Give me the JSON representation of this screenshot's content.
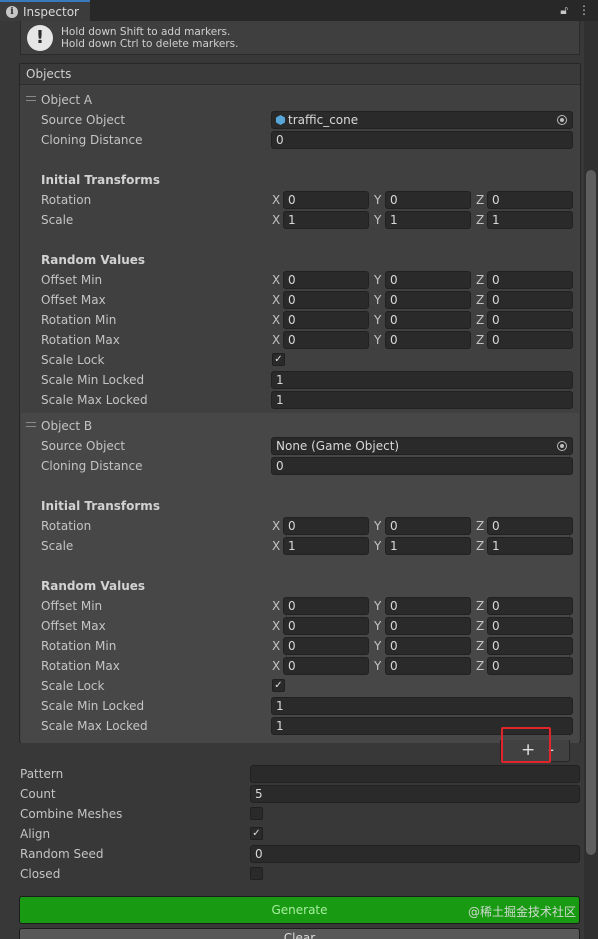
{
  "tab": {
    "title": "Inspector",
    "lock_icon": "lock-icon",
    "menu_icon": "kebab-menu-icon"
  },
  "help": {
    "line1": "Hold down Shift to add markers.",
    "line2": "Hold down Ctrl to delete markers.",
    "icon": "exclamation-icon"
  },
  "objects": {
    "header": "Objects",
    "a": {
      "title": "Object A",
      "source_label": "Source Object",
      "source_value": "traffic_cone",
      "cloning_label": "Cloning Distance",
      "cloning_value": "0",
      "initial_header": "Initial Transforms",
      "rotation_label": "Rotation",
      "rotation": {
        "x": "0",
        "y": "0",
        "z": "0"
      },
      "scale_label": "Scale",
      "scale": {
        "x": "1",
        "y": "1",
        "z": "1"
      },
      "random_header": "Random Values",
      "offset_min_label": "Offset Min",
      "offset_min": {
        "x": "0",
        "y": "0",
        "z": "0"
      },
      "offset_max_label": "Offset Max",
      "offset_max": {
        "x": "0",
        "y": "0",
        "z": "0"
      },
      "rot_min_label": "Rotation Min",
      "rot_min": {
        "x": "0",
        "y": "0",
        "z": "0"
      },
      "rot_max_label": "Rotation Max",
      "rot_max": {
        "x": "0",
        "y": "0",
        "z": "0"
      },
      "scale_lock_label": "Scale Lock",
      "scale_lock": true,
      "scale_min_locked_label": "Scale Min Locked",
      "scale_min_locked": "1",
      "scale_max_locked_label": "Scale Max Locked",
      "scale_max_locked": "1"
    },
    "b": {
      "title": "Object B",
      "source_label": "Source Object",
      "source_value": "None (Game Object)",
      "cloning_label": "Cloning Distance",
      "cloning_value": "0",
      "initial_header": "Initial Transforms",
      "rotation_label": "Rotation",
      "rotation": {
        "x": "0",
        "y": "0",
        "z": "0"
      },
      "scale_label": "Scale",
      "scale": {
        "x": "1",
        "y": "1",
        "z": "1"
      },
      "random_header": "Random Values",
      "offset_min_label": "Offset Min",
      "offset_min": {
        "x": "0",
        "y": "0",
        "z": "0"
      },
      "offset_max_label": "Offset Max",
      "offset_max": {
        "x": "0",
        "y": "0",
        "z": "0"
      },
      "rot_min_label": "Rotation Min",
      "rot_min": {
        "x": "0",
        "y": "0",
        "z": "0"
      },
      "rot_max_label": "Rotation Max",
      "rot_max": {
        "x": "0",
        "y": "0",
        "z": "0"
      },
      "scale_lock_label": "Scale Lock",
      "scale_lock": true,
      "scale_min_locked_label": "Scale Min Locked",
      "scale_min_locked": "1",
      "scale_max_locked_label": "Scale Max Locked",
      "scale_max_locked": "1"
    },
    "add_label": "+",
    "remove_label": "-"
  },
  "axes": {
    "x": "X",
    "y": "Y",
    "z": "Z"
  },
  "props": {
    "pattern_label": "Pattern",
    "pattern_value": "",
    "count_label": "Count",
    "count_value": "5",
    "combine_label": "Combine Meshes",
    "combine_checked": false,
    "align_label": "Align",
    "align_checked": true,
    "seed_label": "Random Seed",
    "seed_value": "0",
    "closed_label": "Closed",
    "closed_checked": false
  },
  "buttons": {
    "generate": "Generate",
    "clear": "Clear"
  },
  "watermark": "@稀土掘金技术社区",
  "colors": {
    "accent": "#3a79bb",
    "generate_bg": "#189a13",
    "highlight": "#e0262a"
  }
}
